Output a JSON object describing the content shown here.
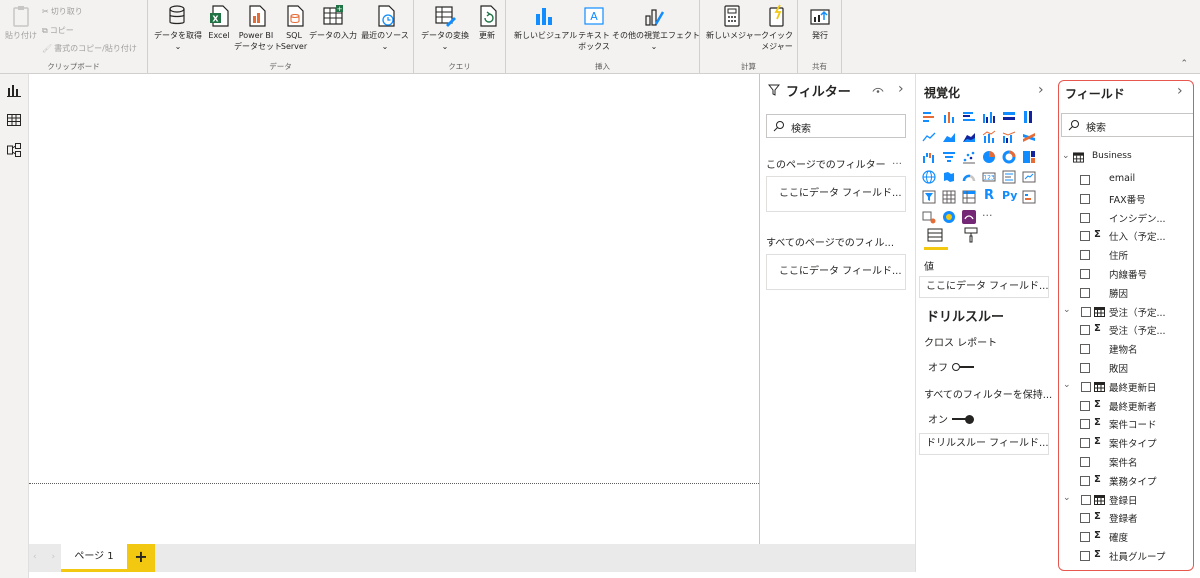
{
  "ribbon": {
    "clipboard": {
      "paste": "貼り付け",
      "cut": "切り取り",
      "copy": "コピー",
      "format_painter": "書式のコピー/貼り付け",
      "group_label": "クリップボード"
    },
    "data": {
      "get_data": "データを取得",
      "excel": "Excel",
      "powerbi_line1": "Power BI",
      "powerbi_line2": "データセット",
      "sql_line1": "SQL",
      "sql_line2": "Server",
      "enter_data": "データの入力",
      "recent_sources": "最近のソース",
      "group_label": "データ"
    },
    "query": {
      "transform": "データの変換",
      "refresh": "更新",
      "group_label": "クエリ"
    },
    "insert": {
      "new_visual": "新しいビジュアル",
      "textbox_line1": "テキスト",
      "textbox_line2": "ボックス",
      "more_visuals": "その他の視覚エフェクト",
      "group_label": "挿入"
    },
    "calc": {
      "new_measure": "新しいメジャー",
      "quick_line1": "クイック",
      "quick_line2": "メジャー",
      "group_label": "計算"
    },
    "share": {
      "publish": "発行",
      "group_label": "共有"
    },
    "dropdown_glyph": "⌄"
  },
  "pages": {
    "nav_arrows": "‹ ›",
    "tab_label": "ページ 1",
    "add_glyph": "+"
  },
  "filters": {
    "title": "フィルター",
    "search_placeholder": "検索",
    "this_page": "このページでのフィルター",
    "all_pages": "すべてのページでのフィル...",
    "drop_here_1": "ここにデータ フィールド...",
    "drop_here_2": "ここにデータ フィールド...",
    "ellipsis": "…",
    "expand_glyph": "›"
  },
  "visualizations": {
    "title": "視覚化",
    "expand_glyph": "›",
    "more_glyph": "···",
    "values_label": "値",
    "values_drop": "ここにデータ フィールド...",
    "drillthrough_title": "ドリルスルー",
    "cross_report": "クロス レポート",
    "cross_report_state": "オフ",
    "keep_all_filters": "すべてのフィルターを保持...",
    "keep_all_filters_state": "オン",
    "drillthrough_drop": "ドリルスルー フィールド...",
    "r_label": "R",
    "py_label": "Py"
  },
  "fields": {
    "title": "フィールド",
    "expand_glyph": "›",
    "search_placeholder": "検索",
    "table_name": "Business",
    "sigma": "Σ",
    "items": [
      {
        "label": "email",
        "kind": "plain"
      },
      {
        "label": "FAX番号",
        "kind": "plain"
      },
      {
        "label": "インシデン...",
        "kind": "plain"
      },
      {
        "label": "仕入（予定...",
        "kind": "sum"
      },
      {
        "label": "住所",
        "kind": "plain"
      },
      {
        "label": "内線番号",
        "kind": "plain"
      },
      {
        "label": "勝因",
        "kind": "plain"
      },
      {
        "label": "受注（予定...",
        "kind": "date"
      },
      {
        "label": "受注（予定...",
        "kind": "sum"
      },
      {
        "label": "建物名",
        "kind": "plain"
      },
      {
        "label": "敗因",
        "kind": "plain"
      },
      {
        "label": "最終更新日",
        "kind": "date"
      },
      {
        "label": "最終更新者",
        "kind": "sum"
      },
      {
        "label": "案件コード",
        "kind": "sum"
      },
      {
        "label": "案件タイプ",
        "kind": "sum"
      },
      {
        "label": "案件名",
        "kind": "plain"
      },
      {
        "label": "業務タイプ",
        "kind": "sum"
      },
      {
        "label": "登録日",
        "kind": "date"
      },
      {
        "label": "登録者",
        "kind": "sum"
      },
      {
        "label": "確度",
        "kind": "sum"
      },
      {
        "label": "社員グループ",
        "kind": "sum"
      }
    ]
  },
  "colors": {
    "accent_yellow": "#f2c811",
    "highlight_red": "#e8574f",
    "excel_green": "#217346",
    "viz_blue": "#118dff",
    "viz_orange": "#e66c37"
  }
}
